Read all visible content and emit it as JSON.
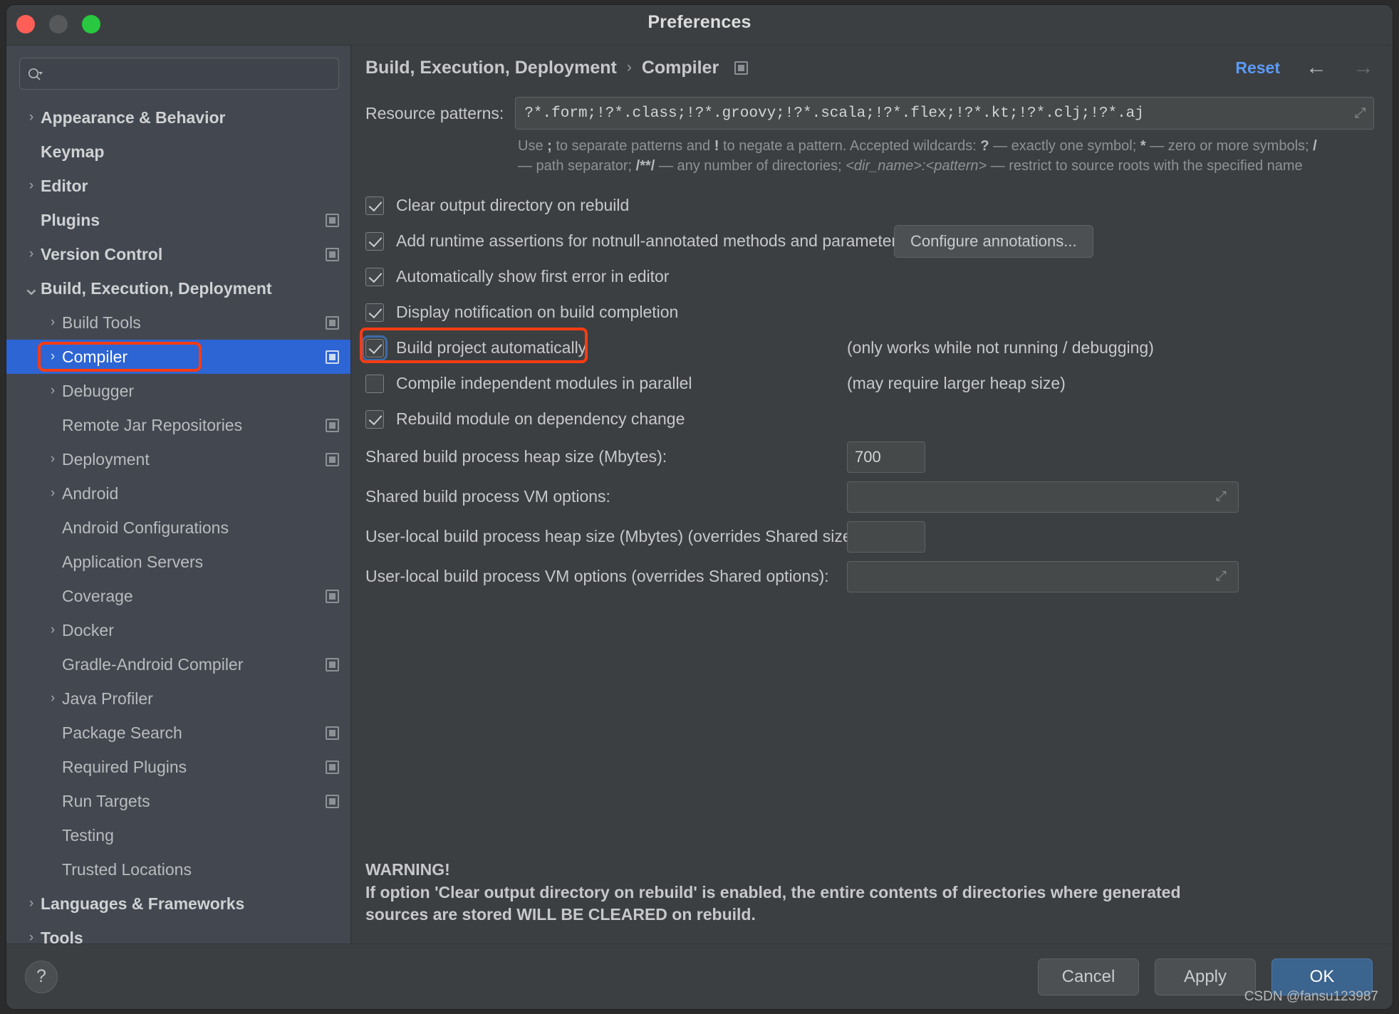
{
  "window": {
    "title": "Preferences",
    "traffic_lights": [
      "close",
      "minimize",
      "maximize"
    ]
  },
  "sidebar": {
    "search": {
      "value": "",
      "placeholder": ""
    },
    "items": [
      {
        "label": "Appearance & Behavior",
        "level": 0,
        "arrow": "right",
        "badge": false,
        "selected": false
      },
      {
        "label": "Keymap",
        "level": 0,
        "arrow": "none",
        "badge": false,
        "selected": false
      },
      {
        "label": "Editor",
        "level": 0,
        "arrow": "right",
        "badge": false,
        "selected": false
      },
      {
        "label": "Plugins",
        "level": 0,
        "arrow": "none",
        "badge": true,
        "selected": false
      },
      {
        "label": "Version Control",
        "level": 0,
        "arrow": "right",
        "badge": true,
        "selected": false
      },
      {
        "label": "Build, Execution, Deployment",
        "level": 0,
        "arrow": "down",
        "badge": false,
        "selected": false
      },
      {
        "label": "Build Tools",
        "level": 1,
        "arrow": "right",
        "badge": true,
        "selected": false
      },
      {
        "label": "Compiler",
        "level": 1,
        "arrow": "right",
        "badge": true,
        "selected": true
      },
      {
        "label": "Debugger",
        "level": 1,
        "arrow": "right",
        "badge": false,
        "selected": false
      },
      {
        "label": "Remote Jar Repositories",
        "level": 1,
        "arrow": "none",
        "badge": true,
        "selected": false
      },
      {
        "label": "Deployment",
        "level": 1,
        "arrow": "right",
        "badge": true,
        "selected": false
      },
      {
        "label": "Android",
        "level": 1,
        "arrow": "right",
        "badge": false,
        "selected": false
      },
      {
        "label": "Android Configurations",
        "level": 1,
        "arrow": "none",
        "badge": false,
        "selected": false
      },
      {
        "label": "Application Servers",
        "level": 1,
        "arrow": "none",
        "badge": false,
        "selected": false
      },
      {
        "label": "Coverage",
        "level": 1,
        "arrow": "none",
        "badge": true,
        "selected": false
      },
      {
        "label": "Docker",
        "level": 1,
        "arrow": "right",
        "badge": false,
        "selected": false
      },
      {
        "label": "Gradle-Android Compiler",
        "level": 1,
        "arrow": "none",
        "badge": true,
        "selected": false
      },
      {
        "label": "Java Profiler",
        "level": 1,
        "arrow": "right",
        "badge": false,
        "selected": false
      },
      {
        "label": "Package Search",
        "level": 1,
        "arrow": "none",
        "badge": true,
        "selected": false
      },
      {
        "label": "Required Plugins",
        "level": 1,
        "arrow": "none",
        "badge": true,
        "selected": false
      },
      {
        "label": "Run Targets",
        "level": 1,
        "arrow": "none",
        "badge": true,
        "selected": false
      },
      {
        "label": "Testing",
        "level": 1,
        "arrow": "none",
        "badge": false,
        "selected": false
      },
      {
        "label": "Trusted Locations",
        "level": 1,
        "arrow": "none",
        "badge": false,
        "selected": false
      },
      {
        "label": "Languages & Frameworks",
        "level": 0,
        "arrow": "right",
        "badge": false,
        "selected": false
      },
      {
        "label": "Tools",
        "level": 0,
        "arrow": "right",
        "badge": false,
        "selected": false
      }
    ]
  },
  "header": {
    "breadcrumb_root": "Build, Execution, Deployment",
    "breadcrumb_sep": "›",
    "breadcrumb_leaf": "Compiler",
    "reset_label": "Reset",
    "back_arrow": "←",
    "forward_arrow": "→"
  },
  "main": {
    "resource_patterns": {
      "label": "Resource patterns:",
      "value": "?*.form;!?*.class;!?*.groovy;!?*.scala;!?*.flex;!?*.kt;!?*.clj;!?*.aj",
      "expand_glyph": "⤡"
    },
    "hint_parts": {
      "p1": "Use ",
      "b1": ";",
      "p2": " to separate patterns and ",
      "b2": "!",
      "p3": " to negate a pattern. Accepted wildcards: ",
      "b3": "?",
      "p4": " — exactly one symbol; ",
      "b4": "*",
      "p5": " — zero or more symbols; ",
      "b5": "/",
      "p6": " — path separator; ",
      "b6": "/**/",
      "p7": " — any number of directories; ",
      "i1": "<dir_name>:<pattern>",
      "p8": " — restrict to source roots with the specified name"
    },
    "checkboxes": [
      {
        "label": "Clear output directory on rebuild",
        "checked": true,
        "focused": false,
        "note": "",
        "button": ""
      },
      {
        "label": "Add runtime assertions for notnull-annotated methods and parameters",
        "checked": true,
        "focused": false,
        "note": "",
        "button": "Configure annotations..."
      },
      {
        "label": "Automatically show first error in editor",
        "checked": true,
        "focused": false,
        "note": "",
        "button": ""
      },
      {
        "label": "Display notification on build completion",
        "checked": true,
        "focused": false,
        "note": "",
        "button": ""
      },
      {
        "label": "Build project automatically",
        "checked": true,
        "focused": true,
        "note": "(only works while not running / debugging)",
        "button": "",
        "annotated": true
      },
      {
        "label": "Compile independent modules in parallel",
        "checked": false,
        "focused": false,
        "note": "(may require larger heap size)",
        "button": ""
      },
      {
        "label": "Rebuild module on dependency change",
        "checked": true,
        "focused": false,
        "note": "",
        "button": ""
      }
    ],
    "fields": [
      {
        "label": "Shared build process heap size (Mbytes):",
        "value": "700",
        "size": "small",
        "expandable": false
      },
      {
        "label": "Shared build process VM options:",
        "value": "",
        "size": "wide",
        "expandable": true
      },
      {
        "label": "User-local build process heap size (Mbytes) (overrides Shared size):",
        "value": "",
        "size": "small",
        "expandable": false
      },
      {
        "label": "User-local build process VM options (overrides Shared options):",
        "value": "",
        "size": "wide",
        "expandable": true
      }
    ],
    "warning": {
      "line1": "WARNING!",
      "line2": "If option 'Clear output directory on rebuild' is enabled, the entire contents of directories where generated",
      "line3": "sources are stored WILL BE CLEARED on rebuild."
    }
  },
  "footer": {
    "help_label": "?",
    "cancel_label": "Cancel",
    "apply_label": "Apply",
    "ok_label": "OK"
  },
  "watermark": "CSDN @fansu123987",
  "colors": {
    "accent_selection": "#2d65d4",
    "accent_link": "#5b9bf8",
    "annotation_red": "#fa3c13",
    "primary_button": "#3b648f",
    "panel_bg": "#3c3f41",
    "sidebar_bg": "#434750"
  }
}
